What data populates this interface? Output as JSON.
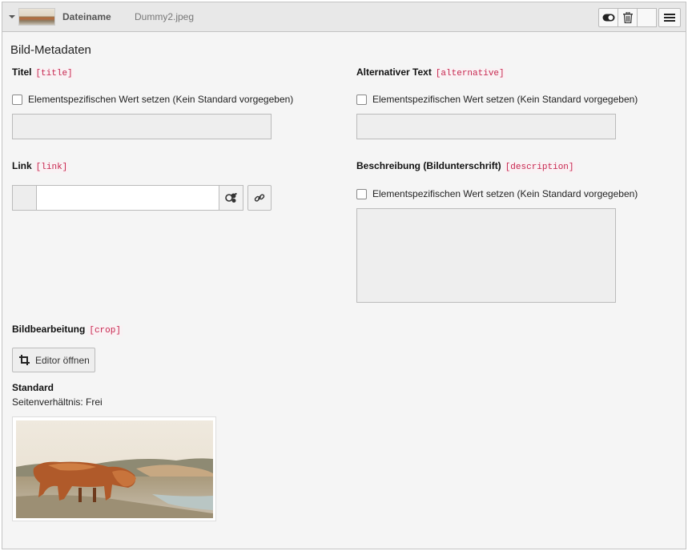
{
  "header": {
    "file_label": "Dateiname",
    "file_value": "Dummy2.jpeg",
    "icons": [
      "caret-down-icon",
      "toggle-icon",
      "trash-icon",
      "menu-icon"
    ]
  },
  "section": {
    "title": "Bild-Metadaten"
  },
  "fields": {
    "title": {
      "label": "Titel",
      "key": "[title]",
      "checkbox_label": "Elementspezifischen Wert setzen (Kein Standard vorgegeben)",
      "value": ""
    },
    "alternative": {
      "label": "Alternativer Text",
      "key": "[alternative]",
      "checkbox_label": "Elementspezifischen Wert setzen (Kein Standard vorgegeben)",
      "value": ""
    },
    "link": {
      "label": "Link",
      "key": "[link]",
      "value": ""
    },
    "description": {
      "label": "Beschreibung (Bildunterschrift)",
      "key": "[description]",
      "checkbox_label": "Elementspezifischen Wert setzen (Kein Standard vorgegeben)",
      "value": ""
    },
    "crop": {
      "label": "Bildbearbeitung",
      "key": "[crop]",
      "button_label": "Editor öffnen",
      "variant_title": "Standard",
      "aspect_ratio": "Seitenverhältnis: Frei"
    }
  },
  "colors": {
    "code_text": "#c7254e",
    "code_bg": "#f9f2f4",
    "panel_bg": "#f5f5f5",
    "header_bg": "#e8e8e8"
  }
}
